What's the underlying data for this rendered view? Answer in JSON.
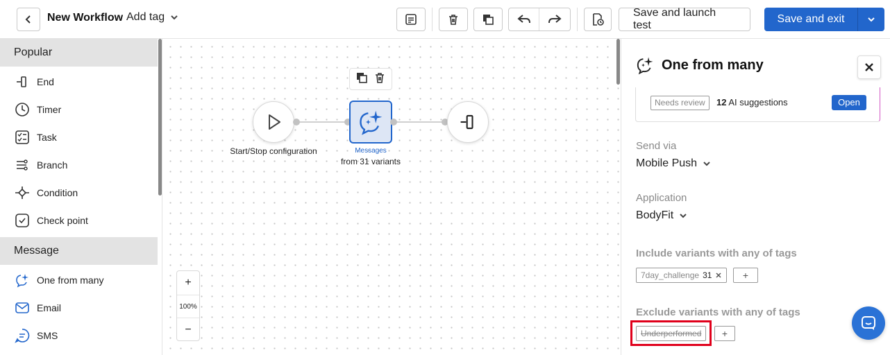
{
  "topbar": {
    "back_icon": "chevron-left-icon",
    "title": "New Workflow",
    "add_tag_label": "Add tag",
    "tools": [
      "notes-icon",
      "trash-icon",
      "copy-icon",
      "undo-icon",
      "redo-icon",
      "test-file-icon"
    ],
    "save_launch_label": "Save and launch test",
    "save_exit_label": "Save and exit",
    "accent": "#2266cc"
  },
  "sidebar": {
    "sections": [
      {
        "title": "Popular",
        "items": [
          {
            "label": "End",
            "icon": "end-icon"
          },
          {
            "label": "Timer",
            "icon": "timer-icon"
          },
          {
            "label": "Task",
            "icon": "task-icon"
          },
          {
            "label": "Branch",
            "icon": "branch-icon"
          },
          {
            "label": "Condition",
            "icon": "condition-icon"
          },
          {
            "label": "Check point",
            "icon": "check-point-icon"
          }
        ]
      },
      {
        "title": "Message",
        "items": [
          {
            "label": "One from many",
            "icon": "ai-message-icon"
          },
          {
            "label": "Email",
            "icon": "email-icon"
          },
          {
            "label": "SMS",
            "icon": "sms-icon"
          }
        ]
      }
    ]
  },
  "canvas": {
    "start_label": "Start/Stop configuration",
    "message_node_type": "Messages",
    "message_node_subtitle": "from 31 variants",
    "zoom_in": "+",
    "zoom_level": "100%",
    "zoom_out": "−"
  },
  "panel": {
    "title": "One from many",
    "close_icon": "close-icon",
    "ai_card": {
      "badge": "Needs review",
      "count": "12",
      "suggestions_text": "AI suggestions",
      "open_label": "Open"
    },
    "send_via_label": "Send via",
    "send_via_value": "Mobile Push",
    "application_label": "Application",
    "application_value": "BodyFit",
    "include_label": "Include variants with any of tags",
    "include_tags": [
      {
        "name": "7day_challenge",
        "count": "31"
      }
    ],
    "exclude_label": "Exclude variants with any of tags",
    "exclude_tags": [
      {
        "name": "Underperformed"
      }
    ],
    "add_symbol": "+",
    "highlight_color": "#e0001b"
  }
}
